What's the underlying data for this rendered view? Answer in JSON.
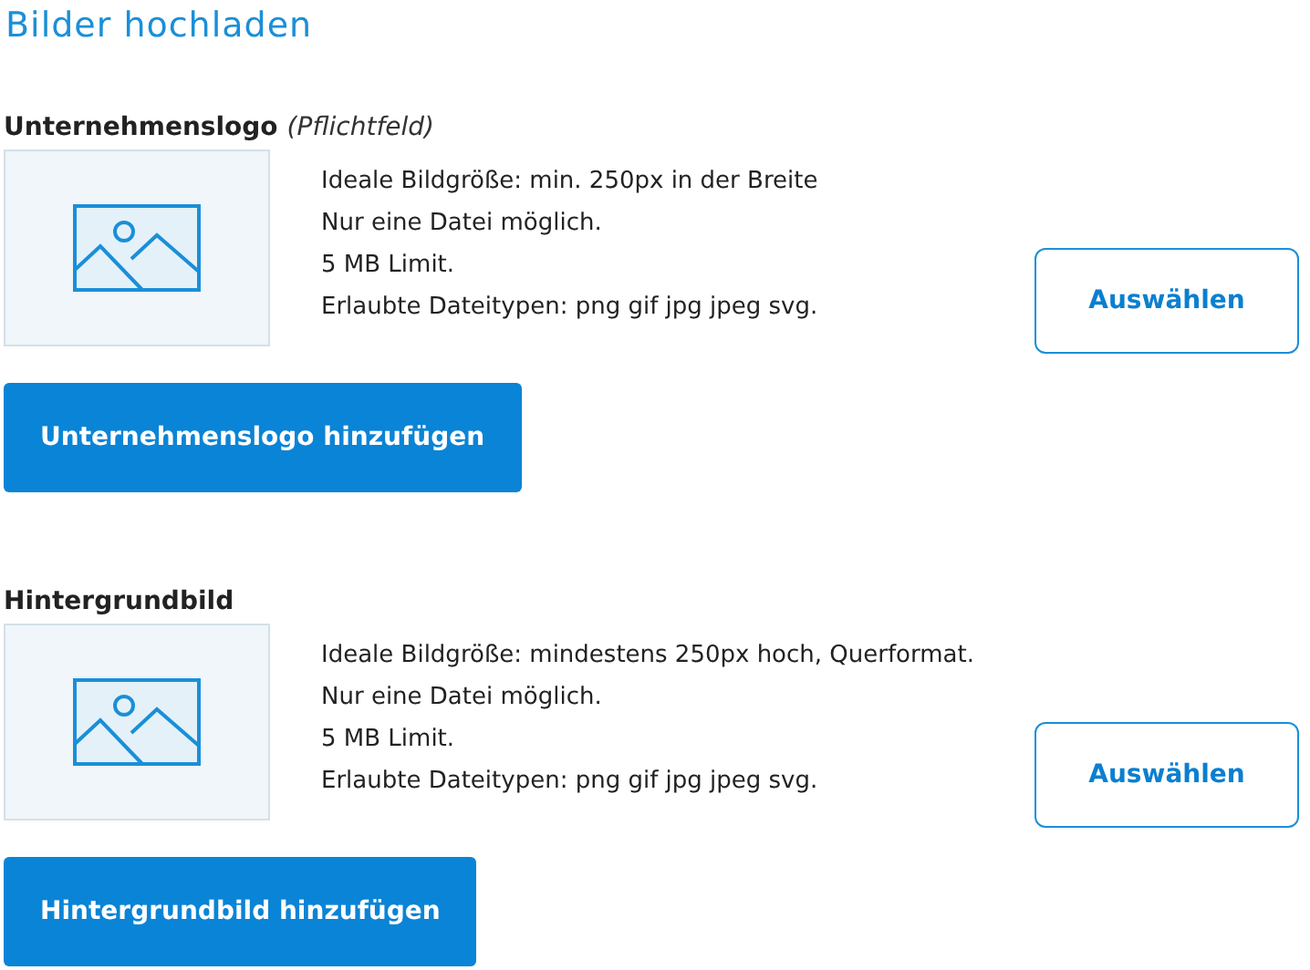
{
  "title": "Bilder hochladen",
  "sections": [
    {
      "label": "Unternehmenslogo",
      "note": "(Pflichtfeld)",
      "info": [
        "Ideale Bildgröße: min. 250px in der Breite",
        "Nur eine Datei möglich.",
        "5 MB Limit.",
        "Erlaubte Dateitypen: png gif jpg jpeg svg."
      ],
      "select_button": "Auswählen",
      "add_button": "Unternehmenslogo hinzufügen"
    },
    {
      "label": "Hintergrundbild",
      "info": [
        "Ideale Bildgröße: mindestens 250px hoch, Querformat.",
        "Nur eine Datei möglich.",
        "5 MB Limit.",
        "Erlaubte Dateitypen: png gif jpg jpeg svg."
      ],
      "select_button": "Auswählen",
      "add_button": "Hintergrundbild hinzufügen"
    }
  ]
}
